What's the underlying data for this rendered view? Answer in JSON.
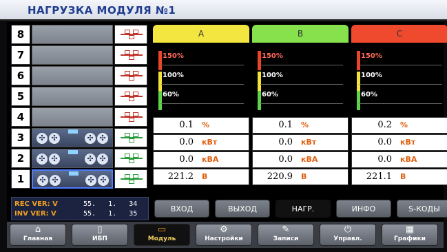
{
  "title": "НАГРУЗКА МОДУЛЯ №1",
  "modules": [
    {
      "num": "8",
      "installed": false,
      "online": false,
      "selected": false
    },
    {
      "num": "7",
      "installed": false,
      "online": false,
      "selected": false
    },
    {
      "num": "6",
      "installed": false,
      "online": false,
      "selected": false
    },
    {
      "num": "5",
      "installed": false,
      "online": false,
      "selected": false
    },
    {
      "num": "4",
      "installed": false,
      "online": false,
      "selected": false
    },
    {
      "num": "3",
      "installed": true,
      "online": true,
      "selected": false
    },
    {
      "num": "2",
      "installed": true,
      "online": true,
      "selected": false
    },
    {
      "num": "1",
      "installed": true,
      "online": true,
      "selected": true
    }
  ],
  "phases": [
    {
      "label": "A",
      "color": "#f3e640",
      "load": "0.1",
      "kw": "0.0",
      "kva": "0.0",
      "volt": "221.2"
    },
    {
      "label": "B",
      "color": "#86e14c",
      "load": "0.1",
      "kw": "0.0",
      "kva": "0.0",
      "volt": "220.9"
    },
    {
      "label": "C",
      "color": "#f04a2e",
      "load": "0.2",
      "kw": "0.0",
      "kva": "0.0",
      "volt": "221.1"
    }
  ],
  "levels": [
    "150%",
    "100%",
    "60%"
  ],
  "units": {
    "load": "%",
    "kw": "кВт",
    "kva": "кВА",
    "volt": "В"
  },
  "versions": {
    "rec_label": "REC VER: V",
    "rec_a": "55.",
    "rec_b": "1.",
    "rec_c": "34",
    "inv_label": "INV VER: V",
    "inv_a": "55.",
    "inv_b": "1.",
    "inv_c": "35"
  },
  "mid_buttons": [
    "ВХОД",
    "ВЫХОД",
    "НАГР.",
    "ИНФО",
    "S-КОДЫ"
  ],
  "mid_active": "НАГР.",
  "nav": [
    {
      "label": "Главная",
      "icon": "home-icon",
      "glyph": "⌂"
    },
    {
      "label": "ИБП",
      "icon": "ups-icon",
      "glyph": "▯"
    },
    {
      "label": "Модуль",
      "icon": "module-icon",
      "glyph": "▭"
    },
    {
      "label": "Настройки",
      "icon": "settings-gears-icon",
      "glyph": "⚙"
    },
    {
      "label": "Записи",
      "icon": "records-icon",
      "glyph": "✎"
    },
    {
      "label": "Управл.",
      "icon": "power-control-icon",
      "glyph": "⏻"
    },
    {
      "label": "Графики",
      "icon": "charts-icon",
      "glyph": "▦"
    }
  ],
  "nav_active": "Модуль"
}
